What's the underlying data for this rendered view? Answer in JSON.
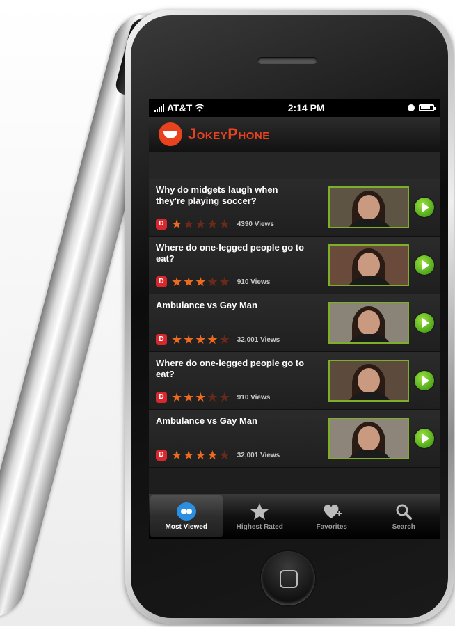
{
  "status_bar": {
    "carrier": "AT&T",
    "time": "2:14 PM"
  },
  "app": {
    "title": "JokeyPhone"
  },
  "videos": [
    {
      "title": "Why do midgets laugh when they're playing soccer?",
      "badge": "D",
      "rating": 1,
      "views": "4390 Views"
    },
    {
      "title": "Where do one-legged people go to eat?",
      "badge": "D",
      "rating": 3,
      "views": "910 Views"
    },
    {
      "title": "Ambulance vs Gay Man",
      "badge": "D",
      "rating": 4,
      "views": "32,001 Views"
    },
    {
      "title": "Where do one-legged people go to eat?",
      "badge": "D",
      "rating": 3,
      "views": "910 Views"
    },
    {
      "title": "Ambulance vs Gay Man",
      "badge": "D",
      "rating": 4,
      "views": "32,001 Views"
    }
  ],
  "tabs": [
    {
      "label": "Most Viewed",
      "icon": "eyes-icon",
      "active": true
    },
    {
      "label": "Highest Rated",
      "icon": "star-icon",
      "active": false
    },
    {
      "label": "Favorites",
      "icon": "heart-plus-icon",
      "active": false
    },
    {
      "label": "Search",
      "icon": "search-icon",
      "active": false
    }
  ],
  "colors": {
    "accent": "#e8421f",
    "play": "#4fa81a",
    "star_on": "#ee6a1e"
  }
}
